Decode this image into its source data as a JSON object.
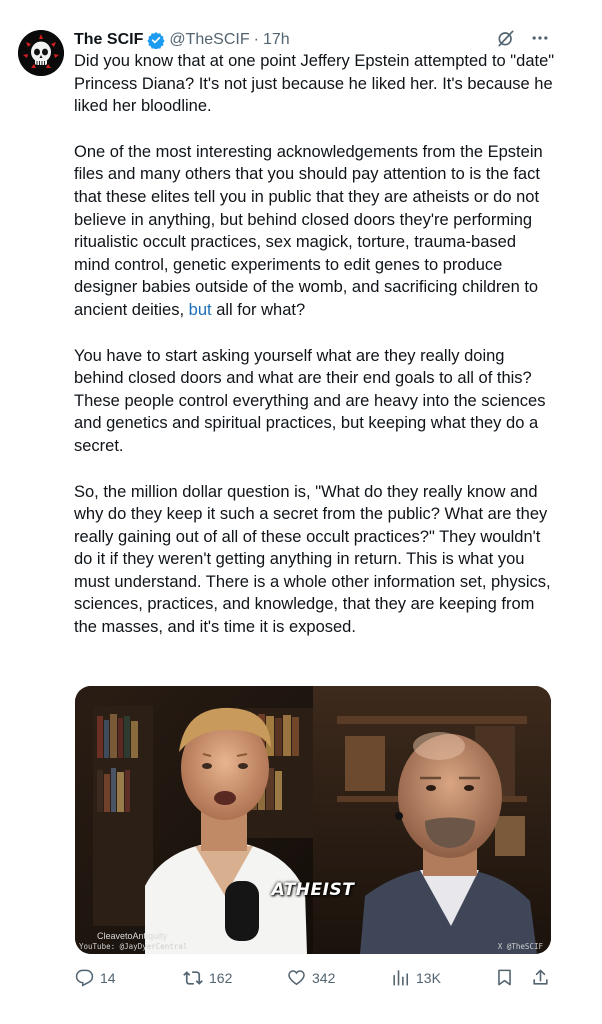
{
  "post": {
    "author_name": "The SCIF",
    "handle": "@TheSCIF",
    "separator": "·",
    "time": "17h",
    "paragraphs": [
      "Did you know that at one point Jeffery Epstein attempted to \"date\" Princess Diana? It's not just because he liked her. It's because he liked her bloodline.",
      "You have to start asking yourself what are they really doing behind closed doors and what are their end goals to all of this? These people control everything and are heavy into the sciences and genetics and spiritual practices, but keeping what they do a secret.",
      "So, the million dollar question is, \"What do they really know and why do they keep it such a secret from the public? What are they really gaining out of all of these occult practices?\" They wouldn't do it if they weren't getting anything in return. This is what you must understand. There is a whole other information set, physics, sciences, practices, and knowledge, that they are keeping from the masses, and it's time it is exposed."
    ],
    "paragraph2_before": "One of the most interesting acknowledgements from the Epstein files and many others that you should pay attention to is the fact that these elites tell you in public that they are atheists or do not believe in anything, but behind closed doors they're performing ritualistic occult practices, sex magick, torture, trauma-based mind control, genetic experiments to edit genes to produce designer babies outside of the womb, and sacrificing children to ancient deities,",
    "paragraph2_link": " but",
    "paragraph2_after": " all for what?"
  },
  "media": {
    "caption": "ATHEIST",
    "watermark_channel": "CleavetoAntiquity",
    "watermark_youtube": "YouTube: @JayDyerCentral",
    "watermark_x": "X @TheSCIF"
  },
  "actions": {
    "replies": "14",
    "reposts": "162",
    "likes": "342",
    "views": "13K"
  },
  "colors": {
    "accent": "#1d9bf0",
    "muted": "#536471",
    "text": "#0f1419"
  },
  "icons": [
    "skull-avatar",
    "verified-badge-icon",
    "grok-icon",
    "more-icon",
    "reply-icon",
    "repost-icon",
    "like-icon",
    "views-icon",
    "bookmark-icon",
    "share-icon"
  ]
}
